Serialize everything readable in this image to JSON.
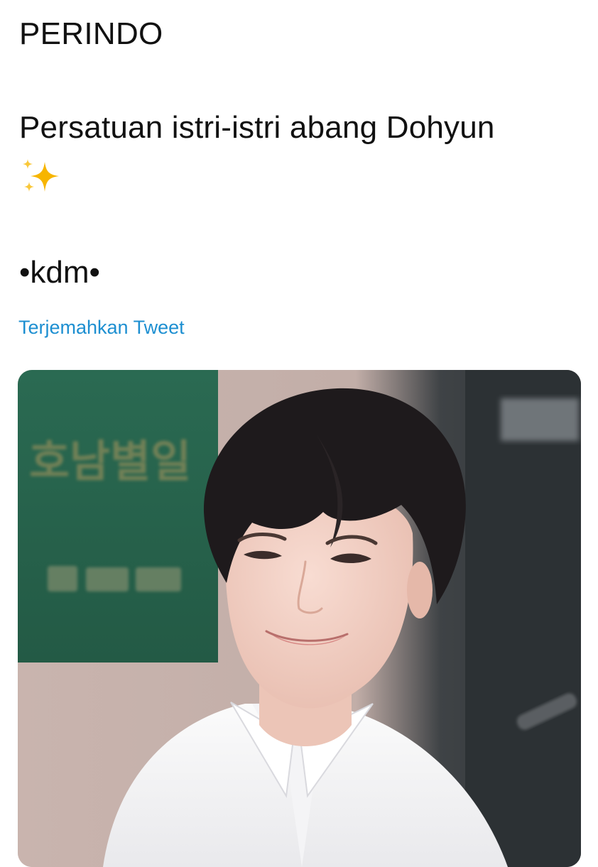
{
  "tweet": {
    "lines": [
      "PERINDO",
      "Persatuan istri-istri abang Dohyun",
      "•kdm•"
    ],
    "emoji_icon": "sparkles-icon",
    "translate_link": "Terjemahkan Tweet",
    "link_color": "#1d8fd1"
  },
  "media": {
    "sign_text": "호남별일"
  }
}
